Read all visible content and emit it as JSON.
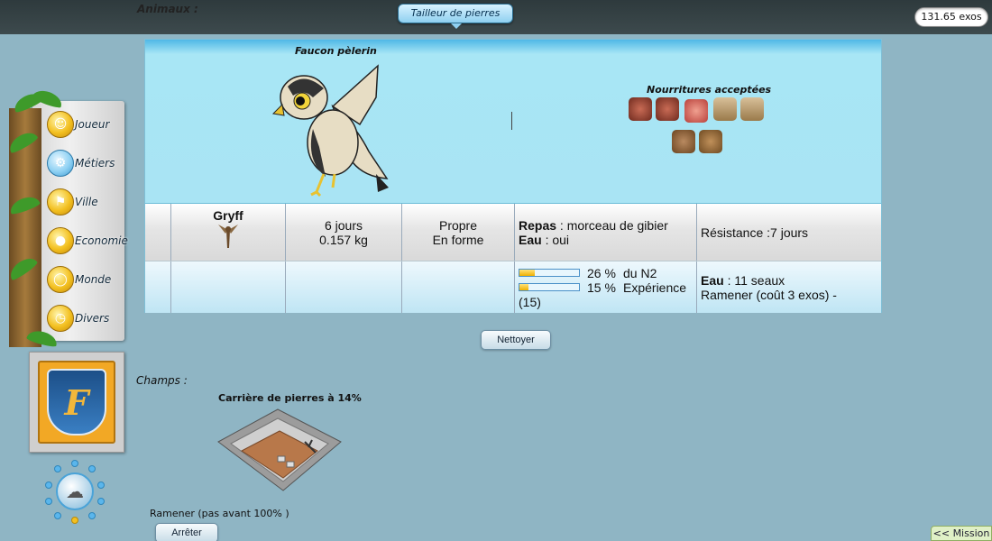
{
  "topbar": {
    "section_label": "Animaux :",
    "active_tab": "Tailleur de pierres",
    "money": "131.65 exos"
  },
  "nav": {
    "items": [
      {
        "label": "Joueur",
        "icon": "player-icon"
      },
      {
        "label": "Métiers",
        "icon": "gears-icon"
      },
      {
        "label": "Ville",
        "icon": "city-icon"
      },
      {
        "label": "Economie",
        "icon": "coins-icon"
      },
      {
        "label": "Monde",
        "icon": "globe-icon"
      },
      {
        "label": "Divers",
        "icon": "clock-icon"
      }
    ],
    "crest_letter": "F"
  },
  "animal": {
    "species": "Faucon pèlerin",
    "foods_title": "Nourritures acceptées",
    "foods": [
      "meat-icon",
      "meat-icon",
      "ham-icon",
      "grain-sack-icon",
      "grain-sack-icon",
      "rabbit-icon",
      "wood-bucket-icon"
    ],
    "name": "Gryff",
    "age": "6 jours",
    "weight": "0.157 kg",
    "cleanliness": "Propre",
    "health": "En forme",
    "meal_label": "Repas",
    "meal_value": " : morceau de gibier",
    "water_label": "Eau",
    "water_value": " : oui",
    "resistance": "Résistance :7 jours",
    "bars": [
      {
        "percent_text": "26 %",
        "label": "du N2",
        "fill": 0.26
      },
      {
        "percent_text": "15 %",
        "label": "Expérience",
        "fill": 0.15
      }
    ],
    "xp_extra": "(15)",
    "water_stock_label": "Eau",
    "water_stock_value": " : 11 seaux",
    "bring_back": "Ramener (coût 3 exos) -"
  },
  "actions": {
    "clean": "Nettoyer",
    "stop": "Arrêter"
  },
  "fields": {
    "label": "Champs :",
    "quarry_title": "Carrière de pierres à 14%",
    "bring_back": "Ramener (pas avant 100% )"
  },
  "mission_tab": "<< Mission",
  "colors": {
    "background": "#8fb5c4",
    "panel": "#a9e4f4",
    "nav_coin": "#f3c020"
  }
}
